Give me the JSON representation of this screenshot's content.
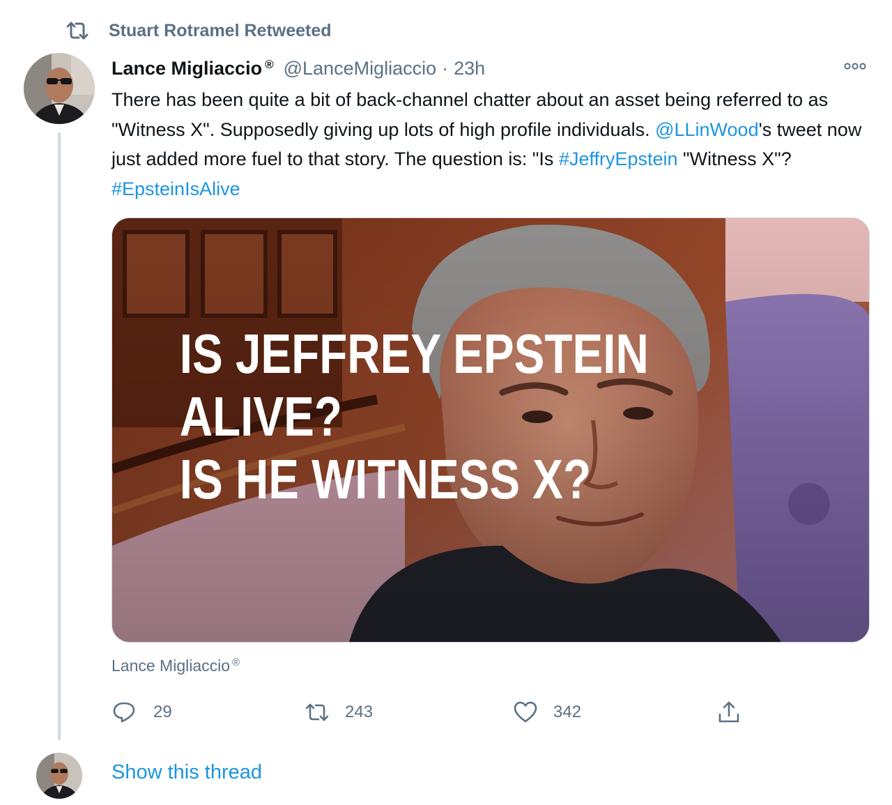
{
  "retweet_context": {
    "label": "Stuart Rotramel Retweeted",
    "icon": "retweet-icon"
  },
  "tweet": {
    "display_name": "Lance Migliaccio",
    "registered_mark": "®",
    "handle": "@LanceMigliaccio",
    "separator": "·",
    "time": "23h",
    "more_icon": "more-options-icon",
    "text": {
      "t1": "There has been quite a bit of back-channel chatter about an asset being referred to as \"Witness X\". Supposedly giving up lots of high profile individuals. ",
      "mention": "@LLinWood",
      "t2": "'s tweet now just added more fuel to that story. The question is: \"Is ",
      "hashtag1": "#JeffryEpstein",
      "t3": " \"Witness X\"? ",
      "hashtag2": "#EpsteinIsAlive"
    },
    "media": {
      "overlay_lines": [
        "IS JEFFREY EPSTEIN",
        "ALIVE?",
        "IS HE WITNESS X?"
      ],
      "caption": "Lance Migliaccio",
      "caption_mark": "®"
    },
    "actions": {
      "reply": {
        "icon": "reply-icon",
        "count": "29"
      },
      "retweet": {
        "icon": "retweet-icon",
        "count": "243"
      },
      "like": {
        "icon": "heart-icon",
        "count": "342"
      },
      "share": {
        "icon": "share-icon"
      }
    }
  },
  "show_thread": {
    "label": "Show this thread"
  },
  "colors": {
    "link": "#1b95e0",
    "muted": "#5b7083",
    "text": "#0f1419",
    "thread_line": "#cfd9de"
  }
}
